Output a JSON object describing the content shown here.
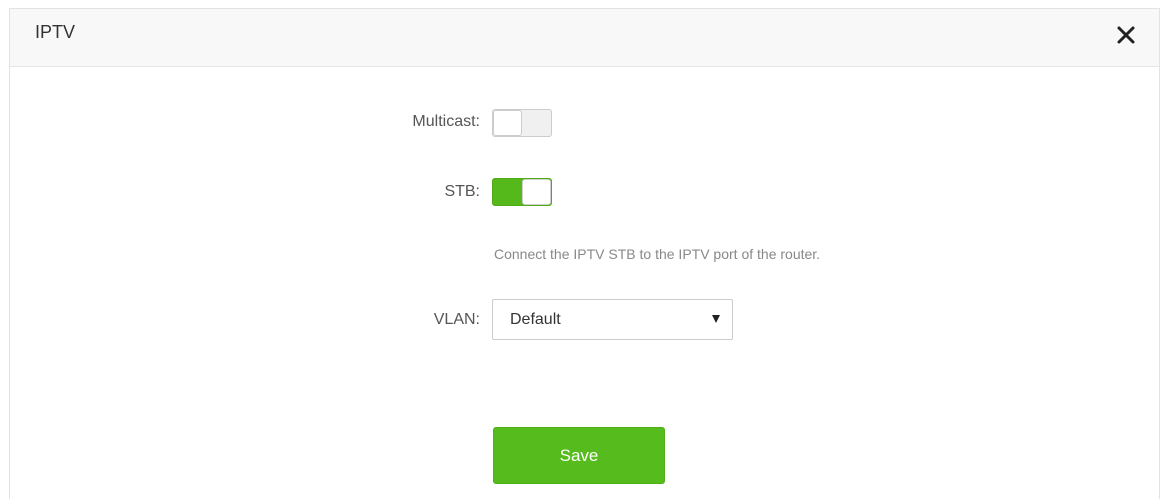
{
  "dialog": {
    "title": "IPTV",
    "close_icon": "close-icon"
  },
  "multicast": {
    "label": "Multicast:",
    "enabled": false
  },
  "stb": {
    "label": "STB:",
    "enabled": true,
    "hint": "Connect the IPTV STB to the IPTV port of the router."
  },
  "vlan": {
    "label": "VLAN:",
    "selected": "Default"
  },
  "actions": {
    "save_label": "Save"
  },
  "colors": {
    "accent_green": "#55b91c"
  }
}
